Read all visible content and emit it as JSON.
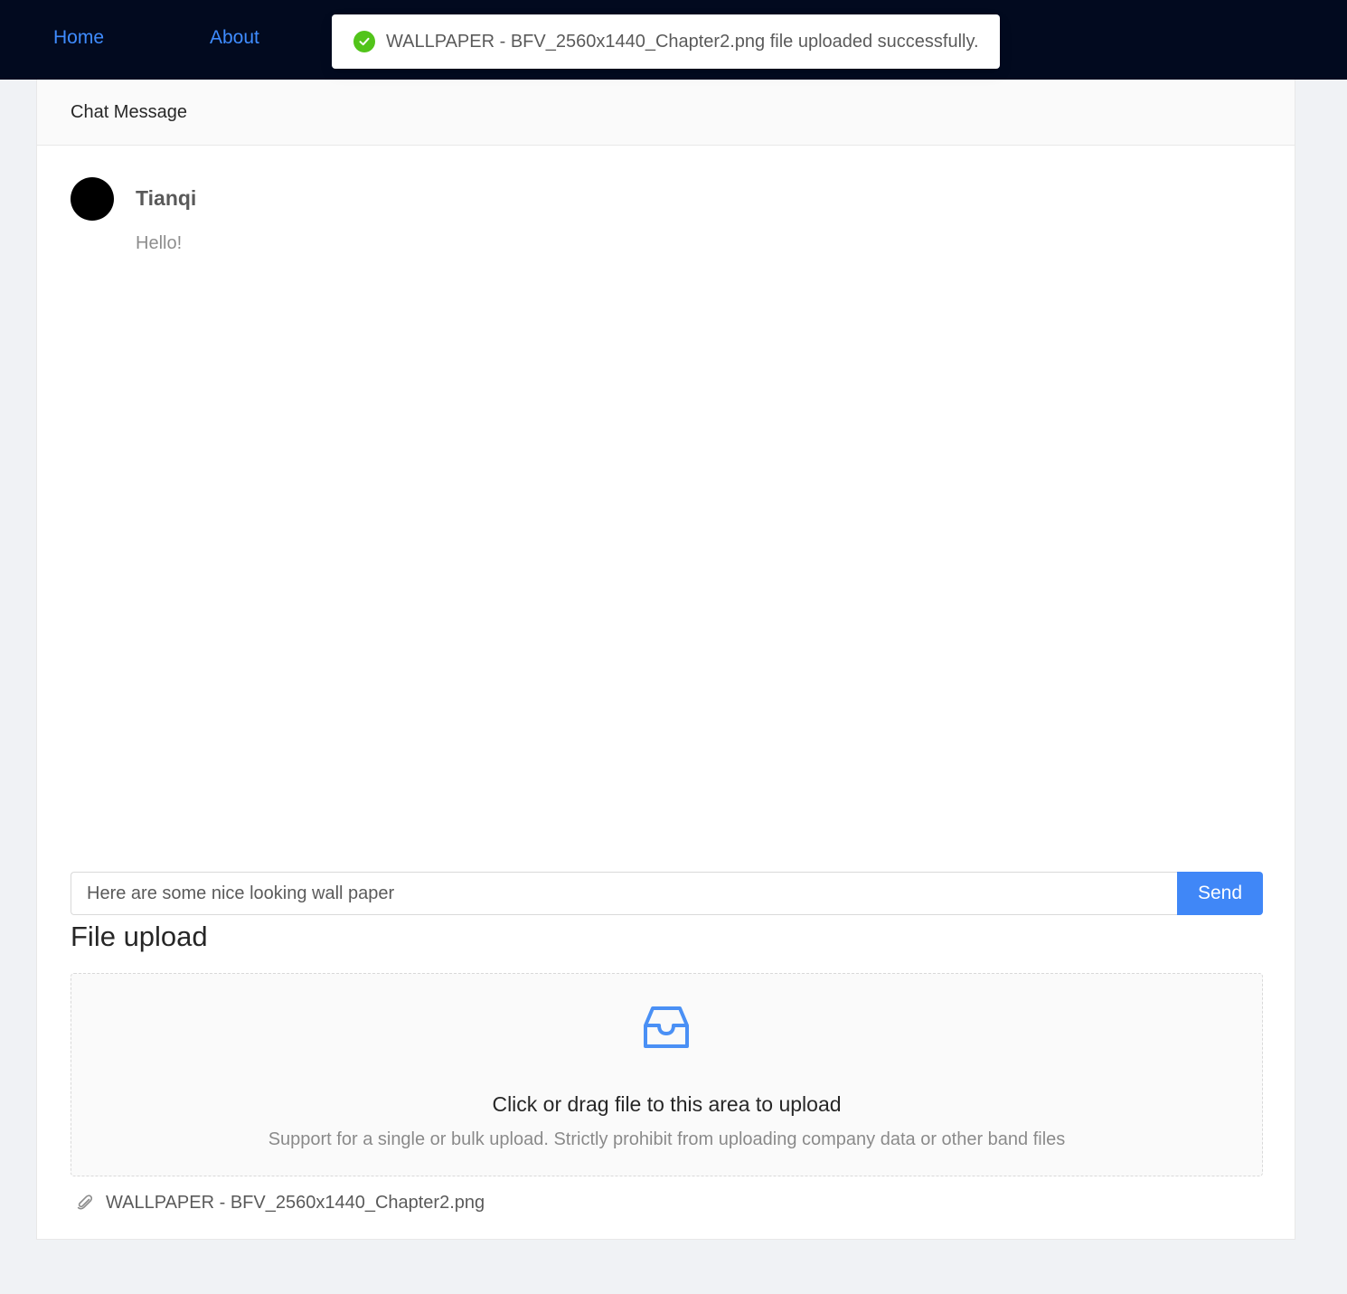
{
  "nav": {
    "home": "Home",
    "about": "About"
  },
  "toast": {
    "message": "WALLPAPER - BFV_2560x1440_Chapter2.png file uploaded successfully.",
    "icon": "check-circle-icon",
    "color": "#52c41a"
  },
  "card": {
    "title": "Chat Message"
  },
  "comment": {
    "author": "Tianqi",
    "text": "Hello!"
  },
  "composer": {
    "value": "Here are some nice looking wall paper",
    "send_label": "Send",
    "accent": "#4087f7"
  },
  "upload": {
    "title": "File upload",
    "drop_text": "Click or drag file to this area to upload",
    "hint": "Support for a single or bulk upload. Strictly prohibit from uploading company data or other band files",
    "icon": "inbox-icon",
    "files": [
      {
        "name": "WALLPAPER - BFV_2560x1440_Chapter2.png",
        "icon": "paperclip-icon"
      }
    ]
  }
}
